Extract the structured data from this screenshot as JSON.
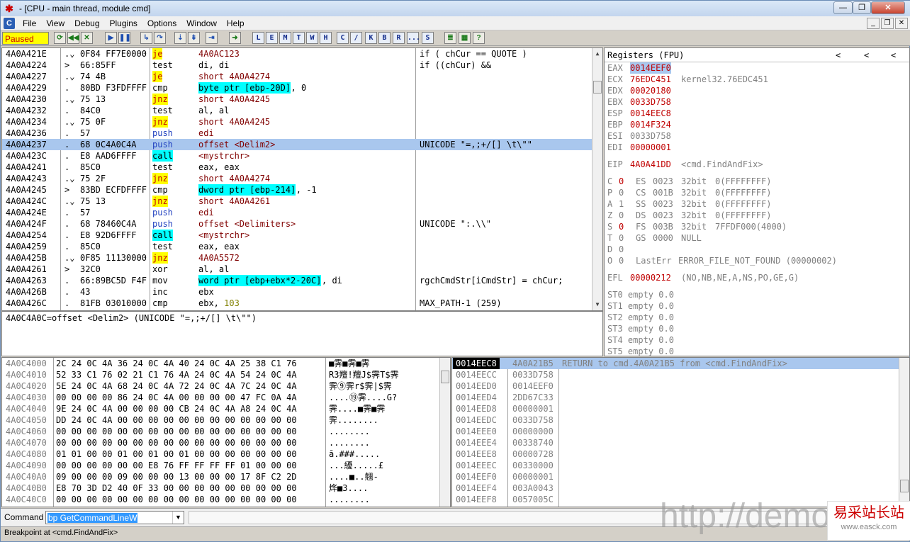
{
  "window": {
    "title": "- [CPU - main thread, module cmd]",
    "app_icon": "bug-icon"
  },
  "menu": [
    "File",
    "View",
    "Debug",
    "Plugins",
    "Options",
    "Window",
    "Help"
  ],
  "toolbar": {
    "status": "Paused",
    "letters": [
      "L",
      "E",
      "M",
      "T",
      "W",
      "H",
      "C",
      "/",
      "K",
      "B",
      "R",
      "...",
      "S"
    ]
  },
  "disasm": {
    "rows": [
      {
        "addr": "4A0A421E",
        "mark": ".⌄",
        "hex": "0F84 FF7E0000",
        "mn": "je",
        "op": "4A0AC123",
        "cm": "if ( chCur == QUOTE )",
        "mst": "y"
      },
      {
        "addr": "4A0A4224",
        "mark": ">",
        "hex": "66:85FF",
        "mn": "test",
        "op": "di, di",
        "cm": "if ((chCur) &&"
      },
      {
        "addr": "4A0A4227",
        "mark": ".⌄",
        "hex": "74 4B",
        "mn": "je",
        "op": "short 4A0A4274",
        "cm": "",
        "mst": "y"
      },
      {
        "addr": "4A0A4229",
        "mark": ".",
        "hex": "80BD F3FDFFFF",
        "mn": "cmp",
        "op": "byte ptr [ebp-20D]",
        "op2": ", 0",
        "cm": "",
        "ost": "c"
      },
      {
        "addr": "4A0A4230",
        "mark": ".⌄",
        "hex": "75 13",
        "mn": "jnz",
        "op": "short 4A0A4245",
        "cm": "",
        "mst": "y"
      },
      {
        "addr": "4A0A4232",
        "mark": ".",
        "hex": "84C0",
        "mn": "test",
        "op": "al, al",
        "cm": ""
      },
      {
        "addr": "4A0A4234",
        "mark": ".⌄",
        "hex": "75 0F",
        "mn": "jnz",
        "op": "short 4A0A4245",
        "cm": "",
        "mst": "y"
      },
      {
        "addr": "4A0A4236",
        "mark": ".",
        "hex": "57",
        "mn": "push",
        "op": "edi",
        "cm": "",
        "mst": "b"
      },
      {
        "addr": "4A0A4237",
        "mark": ".",
        "hex": "68 0C4A0C4A",
        "mn": "push",
        "op": "offset <Delim2>",
        "cm": "UNICODE \"=,;+/[] \\t\\\"\"",
        "mst": "b",
        "sel": true
      },
      {
        "addr": "4A0A423C",
        "mark": ".",
        "hex": "E8 AAD6FFFF",
        "mn": "call",
        "op": "<mystrchr>",
        "cm": "",
        "mst": "c"
      },
      {
        "addr": "4A0A4241",
        "mark": ".",
        "hex": "85C0",
        "mn": "test",
        "op": "eax, eax",
        "cm": ""
      },
      {
        "addr": "4A0A4243",
        "mark": ".⌄",
        "hex": "75 2F",
        "mn": "jnz",
        "op": "short 4A0A4274",
        "cm": "",
        "mst": "y"
      },
      {
        "addr": "4A0A4245",
        "mark": ">",
        "hex": "83BD ECFDFFFF",
        "mn": "cmp",
        "op": "dword ptr [ebp-214]",
        "op2": ", -1",
        "cm": "",
        "ost": "c"
      },
      {
        "addr": "4A0A424C",
        "mark": ".⌄",
        "hex": "75 13",
        "mn": "jnz",
        "op": "short 4A0A4261",
        "cm": "",
        "mst": "y"
      },
      {
        "addr": "4A0A424E",
        "mark": ".",
        "hex": "57",
        "mn": "push",
        "op": "edi",
        "cm": "",
        "mst": "b"
      },
      {
        "addr": "4A0A424F",
        "mark": ".",
        "hex": "68 78460C4A",
        "mn": "push",
        "op": "offset <Delimiters>",
        "cm": "UNICODE \":.\\\\\"",
        "mst": "b"
      },
      {
        "addr": "4A0A4254",
        "mark": ".",
        "hex": "E8 92D6FFFF",
        "mn": "call",
        "op": "<mystrchr>",
        "cm": "",
        "mst": "c"
      },
      {
        "addr": "4A0A4259",
        "mark": ".",
        "hex": "85C0",
        "mn": "test",
        "op": "eax, eax",
        "cm": ""
      },
      {
        "addr": "4A0A425B",
        "mark": ".⌄",
        "hex": "0F85 11130000",
        "mn": "jnz",
        "op": "4A0A5572",
        "cm": "",
        "mst": "y"
      },
      {
        "addr": "4A0A4261",
        "mark": ">",
        "hex": "32C0",
        "mn": "xor",
        "op": "al, al",
        "cm": ""
      },
      {
        "addr": "4A0A4263",
        "mark": ".",
        "hex": "66:89BC5D F4F",
        "mn": "mov",
        "op": "word ptr [ebp+ebx*2-20C]",
        "op2": ", di",
        "cm": "rgchCmdStr[iCmdStr] = chCur;",
        "ost": "c"
      },
      {
        "addr": "4A0A426B",
        "mark": ".",
        "hex": "43",
        "mn": "inc",
        "op": "ebx",
        "cm": ""
      },
      {
        "addr": "4A0A426C",
        "mark": ".",
        "hex": "81FB 03010000",
        "mn": "cmp",
        "op": "ebx, 103",
        "cm": "MAX_PATH-1 (259)",
        "num": true
      }
    ],
    "info": "4A0C4A0C=offset <Delim2> (UNICODE \"=,;+/[] \\t\\\"\")"
  },
  "registers": {
    "header": "Registers (FPU)",
    "gp": [
      {
        "n": "EAX",
        "v": "0014EEF0",
        "x": "",
        "sel": true
      },
      {
        "n": "ECX",
        "v": "76EDC451",
        "x": "kernel32.76EDC451"
      },
      {
        "n": "EDX",
        "v": "00020180",
        "x": ""
      },
      {
        "n": "EBX",
        "v": "0033D758",
        "x": ""
      },
      {
        "n": "ESP",
        "v": "0014EEC8",
        "x": ""
      },
      {
        "n": "EBP",
        "v": "0014F324",
        "x": ""
      },
      {
        "n": "ESI",
        "v": "0033D758",
        "x": "",
        "gray": true
      },
      {
        "n": "EDI",
        "v": "00000001",
        "x": ""
      }
    ],
    "eip": {
      "n": "EIP",
      "v": "4A0A41DD",
      "x": "<cmd.FindAndFix>"
    },
    "flags": [
      {
        "f": "C",
        "b": "0",
        "red": true,
        "s": "ES",
        "sv": "0023",
        "bits": "32bit",
        "base": "0(FFFFFFFF)"
      },
      {
        "f": "P",
        "b": "0",
        "s": "CS",
        "sv": "001B",
        "bits": "32bit",
        "base": "0(FFFFFFFF)"
      },
      {
        "f": "A",
        "b": "1",
        "s": "SS",
        "sv": "0023",
        "bits": "32bit",
        "base": "0(FFFFFFFF)"
      },
      {
        "f": "Z",
        "b": "0",
        "s": "DS",
        "sv": "0023",
        "bits": "32bit",
        "base": "0(FFFFFFFF)"
      },
      {
        "f": "S",
        "b": "0",
        "red": true,
        "s": "FS",
        "sv": "003B",
        "bits": "32bit",
        "base": "7FFDF000(4000)"
      },
      {
        "f": "T",
        "b": "0",
        "s": "GS",
        "sv": "0000",
        "bits": "NULL",
        "base": ""
      },
      {
        "f": "D",
        "b": "0",
        "s": "",
        "sv": "",
        "bits": "",
        "base": ""
      },
      {
        "f": "O",
        "b": "0",
        "s": "LastErr",
        "sv": "ERROR_FILE_NOT_FOUND (00000002)",
        "bits": "",
        "base": ""
      }
    ],
    "efl": {
      "n": "EFL",
      "v": "00000212",
      "x": "(NO,NB,NE,A,NS,PO,GE,G)"
    },
    "fpu": [
      "ST0 empty 0.0",
      "ST1 empty 0.0",
      "ST2 empty 0.0",
      "ST3 empty 0.0",
      "ST4 empty 0.0",
      "ST5 empty 0.0"
    ]
  },
  "dump": [
    {
      "a": "4A0C4000",
      "h": "2C 24 0C 4A 36 24 0C 4A 40 24 0C 4A 25 38 C1 76",
      "s": "■霁■霁■霁"
    },
    {
      "a": "4A0C4010",
      "h": "52 33 C1 76 02 21 C1 76 4A 24 0C 4A 54 24 0C 4A",
      "s": "R3羶!羶J$霁T$霁"
    },
    {
      "a": "4A0C4020",
      "h": "5E 24 0C 4A 68 24 0C 4A 72 24 0C 4A 7C 24 0C 4A",
      "s": "霁⑨霁r$霁|$霁"
    },
    {
      "a": "4A0C4030",
      "h": "00 00 00 00 86 24 0C 4A 00 00 00 00 47 FC 0A 4A",
      "s": "....⑲霁....G?"
    },
    {
      "a": "4A0C4040",
      "h": "9E 24 0C 4A 00 00 00 00 CB 24 0C 4A A8 24 0C 4A",
      "s": "霁....■霁■霁"
    },
    {
      "a": "4A0C4050",
      "h": "DD 24 0C 4A 00 00 00 00 00 00 00 00 00 00 00 00",
      "s": "霁........"
    },
    {
      "a": "4A0C4060",
      "h": "00 00 00 00 00 00 00 00 00 00 00 00 00 00 00 00",
      "s": "........"
    },
    {
      "a": "4A0C4070",
      "h": "00 00 00 00 00 00 00 00 00 00 00 00 00 00 00 00",
      "s": "........"
    },
    {
      "a": "4A0C4080",
      "h": "01 01 00 00 01 00 01 00 01 00 00 00 00 00 00 00",
      "s": "ā.###....."
    },
    {
      "a": "4A0C4090",
      "h": "00 00 00 00 00 00 E8 76 FF FF FF FF 01 00 00 00",
      "s": "...纋.....£"
    },
    {
      "a": "4A0C40A0",
      "h": "09 00 00 00 09 00 00 00 13 00 00 00 17 8F C2 2D",
      "s": "....■..翹-"
    },
    {
      "a": "4A0C40B0",
      "h": "E8 70 3D D2 40 0F 33 00 00 00 00 00 00 00 00 00",
      "s": "烨■3...."
    },
    {
      "a": "4A0C40C0",
      "h": "00 00 00 00 00 00 00 00 00 00 00 00 00 00 00 00",
      "s": "........"
    }
  ],
  "stack": [
    {
      "a": "0014EEC8",
      "v": "4A0A21B5",
      "c": "RETURN to cmd.4A0A21B5 from <cmd.FindAndFix>",
      "sel": true
    },
    {
      "a": "0014EECC",
      "v": "0033D758",
      "c": ""
    },
    {
      "a": "0014EED0",
      "v": "0014EEF0",
      "c": ""
    },
    {
      "a": "0014EED4",
      "v": "2DD67C33",
      "c": ""
    },
    {
      "a": "0014EED8",
      "v": "00000001",
      "c": ""
    },
    {
      "a": "0014EEDC",
      "v": "0033D758",
      "c": ""
    },
    {
      "a": "0014EEE0",
      "v": "00000000",
      "c": ""
    },
    {
      "a": "0014EEE4",
      "v": "00338740",
      "c": ""
    },
    {
      "a": "0014EEE8",
      "v": "00000728",
      "c": ""
    },
    {
      "a": "0014EEEC",
      "v": "00330000",
      "c": ""
    },
    {
      "a": "0014EEF0",
      "v": "00000001",
      "c": ""
    },
    {
      "a": "0014EEF4",
      "v": "003A0043",
      "c": ""
    },
    {
      "a": "0014EEF8",
      "v": "0057005C",
      "c": ""
    }
  ],
  "command": {
    "label": "Command",
    "value": "bp GetCommandLineW"
  },
  "status": "Breakpoint at <cmd.FindAndFix>",
  "watermark": {
    "text": "http://demo",
    "badge1": "易采站长站",
    "badge2": "www.easck.com"
  }
}
